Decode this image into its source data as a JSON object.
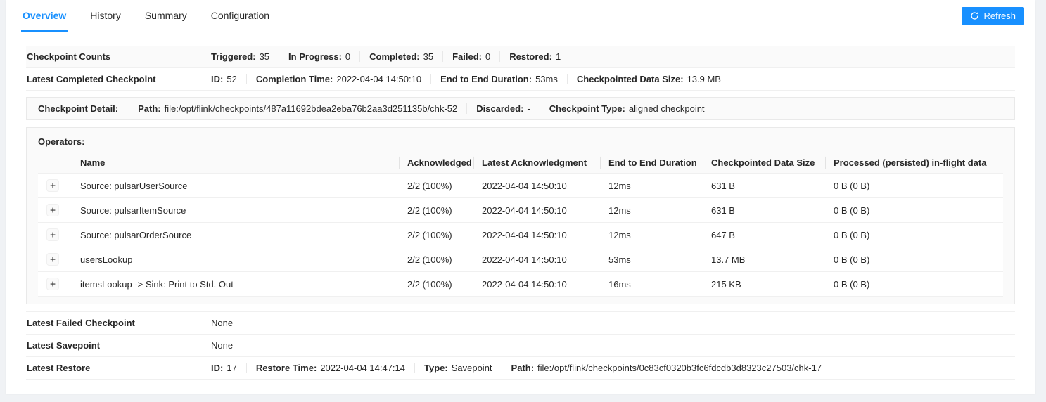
{
  "colors": {
    "accent": "#1890ff",
    "page_bg": "#f0f2f5",
    "row_alt_bg": "#fafafa"
  },
  "tabs": {
    "items": [
      {
        "label": "Overview"
      },
      {
        "label": "History"
      },
      {
        "label": "Summary"
      },
      {
        "label": "Configuration"
      }
    ],
    "active": "Overview"
  },
  "toolbar": {
    "refresh_label": "Refresh"
  },
  "rows": {
    "counts": {
      "label": "Checkpoint Counts",
      "items": [
        {
          "k": "Triggered:",
          "v": "35"
        },
        {
          "k": "In Progress:",
          "v": "0"
        },
        {
          "k": "Completed:",
          "v": "35"
        },
        {
          "k": "Failed:",
          "v": "0"
        },
        {
          "k": "Restored:",
          "v": "1"
        }
      ]
    },
    "latest_completed": {
      "label": "Latest Completed Checkpoint",
      "items": [
        {
          "k": "ID:",
          "v": "52"
        },
        {
          "k": "Completion Time:",
          "v": "2022-04-04 14:50:10"
        },
        {
          "k": "End to End Duration:",
          "v": "53ms"
        },
        {
          "k": "Checkpointed Data Size:",
          "v": "13.9 MB"
        }
      ]
    },
    "detail": {
      "label": "Checkpoint Detail:",
      "items": [
        {
          "k": "Path:",
          "v": "file:/opt/flink/checkpoints/487a11692bdea2eba76b2aa3d251135b/chk-52"
        },
        {
          "k": "Discarded:",
          "v": "-"
        },
        {
          "k": "Checkpoint Type:",
          "v": "aligned checkpoint"
        }
      ]
    },
    "operators": {
      "label": "Operators:",
      "expand_icon": "+",
      "columns": [
        "Name",
        "Acknowledged",
        "Latest Acknowledgment",
        "End to End Duration",
        "Checkpointed Data Size",
        "Processed (persisted) in-flight data"
      ],
      "rows": [
        {
          "name": "Source: pulsarUserSource",
          "acknowledged": "2/2 (100%)",
          "latest_ack": "2022-04-04 14:50:10",
          "duration": "12ms",
          "size": "631 B",
          "inflight": "0 B (0 B)"
        },
        {
          "name": "Source: pulsarItemSource",
          "acknowledged": "2/2 (100%)",
          "latest_ack": "2022-04-04 14:50:10",
          "duration": "12ms",
          "size": "631 B",
          "inflight": "0 B (0 B)"
        },
        {
          "name": "Source: pulsarOrderSource",
          "acknowledged": "2/2 (100%)",
          "latest_ack": "2022-04-04 14:50:10",
          "duration": "12ms",
          "size": "647 B",
          "inflight": "0 B (0 B)"
        },
        {
          "name": "usersLookup",
          "acknowledged": "2/2 (100%)",
          "latest_ack": "2022-04-04 14:50:10",
          "duration": "53ms",
          "size": "13.7 MB",
          "inflight": "0 B (0 B)"
        },
        {
          "name": "itemsLookup -> Sink: Print to Std. Out",
          "acknowledged": "2/2 (100%)",
          "latest_ack": "2022-04-04 14:50:10",
          "duration": "16ms",
          "size": "215 KB",
          "inflight": "0 B (0 B)"
        }
      ]
    },
    "latest_failed": {
      "label": "Latest Failed Checkpoint",
      "value": "None"
    },
    "latest_savepoint": {
      "label": "Latest Savepoint",
      "value": "None"
    },
    "latest_restore": {
      "label": "Latest Restore",
      "items": [
        {
          "k": "ID:",
          "v": "17"
        },
        {
          "k": "Restore Time:",
          "v": "2022-04-04 14:47:14"
        },
        {
          "k": "Type:",
          "v": "Savepoint"
        },
        {
          "k": "Path:",
          "v": "file:/opt/flink/checkpoints/0c83cf0320b3fc6fdcdb3d8323c27503/chk-17"
        }
      ]
    }
  }
}
